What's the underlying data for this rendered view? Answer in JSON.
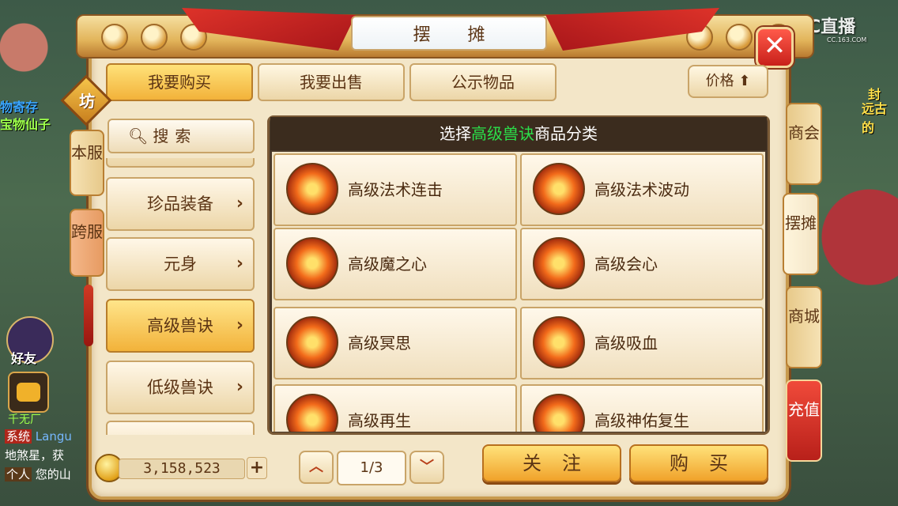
{
  "window": {
    "title": "摆 摊",
    "close_label": "✕"
  },
  "watermark": {
    "brand": "CC直播",
    "url": "CC.163.COM"
  },
  "background": {
    "left_names": [
      "物寄存",
      "宝物仙子"
    ],
    "right_names": [
      "封",
      "远古的"
    ],
    "friend_label": "好友",
    "chat": [
      {
        "tag": "系统",
        "text": "Langu"
      },
      {
        "tag": "",
        "text": "地煞星，获"
      },
      {
        "tag": "个人",
        "text": "您的山"
      }
    ],
    "chat_player": "千无厂"
  },
  "top_tabs": [
    {
      "label": "我要购买",
      "active": true
    },
    {
      "label": "我要出售",
      "active": false
    },
    {
      "label": "公示物品",
      "active": false
    }
  ],
  "price_sort": {
    "label": "价格",
    "arrow": "⬆"
  },
  "left_badge": "坊",
  "server_tabs": [
    {
      "label": "本服",
      "active": true
    },
    {
      "label": "跨服",
      "active": false
    }
  ],
  "right_tabs": [
    {
      "label": "商会",
      "active": false
    },
    {
      "label": "摆摊",
      "active": true
    },
    {
      "label": "商城",
      "active": false
    },
    {
      "label": "充值",
      "active": false
    }
  ],
  "search": {
    "label": "搜索",
    "icon": "search-icon"
  },
  "categories": [
    {
      "label": "珍品装备",
      "active": false
    },
    {
      "label": "元身",
      "active": false
    },
    {
      "label": "高级兽诀",
      "active": true
    },
    {
      "label": "低级兽诀",
      "active": false
    }
  ],
  "goods_header": {
    "prefix": "选择",
    "highlight": "高级兽诀",
    "suffix": "商品分类",
    "highlight_color": "#2be04a"
  },
  "goods": [
    {
      "name": "高级法术连击"
    },
    {
      "name": "高级法术波动"
    },
    {
      "name": "高级魔之心"
    },
    {
      "name": "高级会心"
    },
    {
      "name": "高级冥思"
    },
    {
      "name": "高级吸血"
    },
    {
      "name": "高级再生"
    },
    {
      "name": "高级神佑复生"
    }
  ],
  "money": {
    "value": "3,158,523",
    "add_label": "+"
  },
  "pager": {
    "prev": "︿",
    "next": "﹀",
    "current": "1/3"
  },
  "actions": {
    "follow": "关注",
    "buy": "购买"
  }
}
